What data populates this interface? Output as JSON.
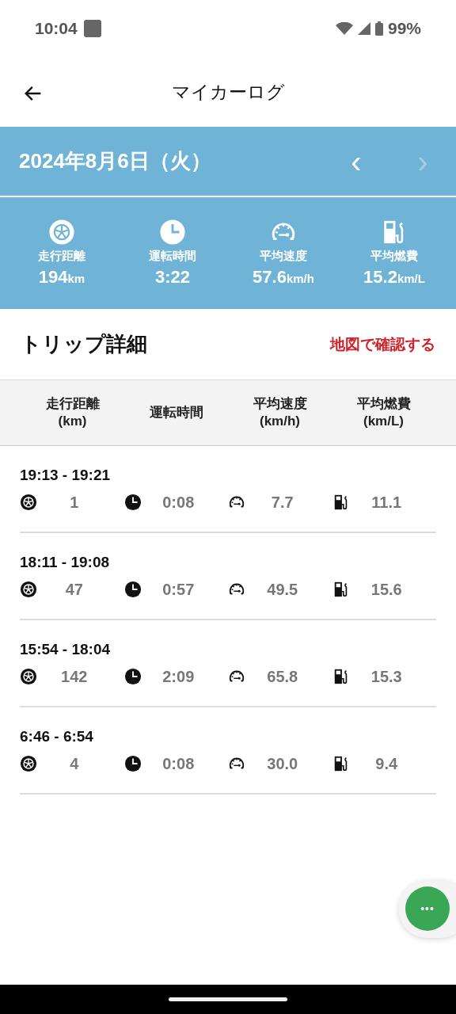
{
  "status_bar": {
    "time": "10:04",
    "battery": "99%"
  },
  "app_bar": {
    "title": "マイカーログ"
  },
  "date_bar": {
    "date": "2024年8月6日（火）",
    "prev": {
      "label": "‹",
      "disabled": false
    },
    "next": {
      "label": "›",
      "disabled": true
    }
  },
  "summary": [
    {
      "label": "走行距離",
      "value": "194",
      "unit": "km"
    },
    {
      "label": "運転時間",
      "value": "3:22"
    },
    {
      "label": "平均速度",
      "value": "57.6",
      "unit": "km/h"
    },
    {
      "label": "平均燃費",
      "value": "15.2",
      "unit": "km/L"
    }
  ],
  "trip_section": {
    "title": "トリップ詳細",
    "map_link": "地図で確認する"
  },
  "table": {
    "columns": [
      {
        "label": "走行距離",
        "unit": "(km)"
      },
      {
        "label": "運転時間"
      },
      {
        "label": "平均速度",
        "unit": "(km/h)"
      },
      {
        "label": "平均燃費",
        "unit": "(km/L)"
      }
    ],
    "rows": [
      {
        "time": "19:13 - 19:21",
        "values": [
          "1",
          "0:08",
          "7.7",
          "11.1"
        ]
      },
      {
        "time": "18:11 - 19:08",
        "values": [
          "47",
          "0:57",
          "49.5",
          "15.6"
        ]
      },
      {
        "time": "15:54 - 18:04",
        "values": [
          "142",
          "2:09",
          "65.8",
          "15.3"
        ]
      },
      {
        "time": "6:46 - 6:54",
        "values": [
          "4",
          "0:08",
          "30.0",
          "9.4"
        ]
      }
    ]
  },
  "fab": {
    "label": "•••"
  }
}
